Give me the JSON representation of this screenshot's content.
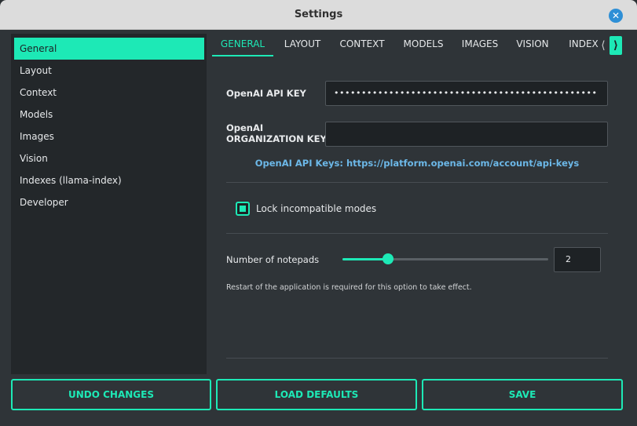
{
  "window": {
    "title": "Settings",
    "close_symbol": "✕"
  },
  "sidebar": {
    "items": [
      {
        "label": "General",
        "active": true
      },
      {
        "label": "Layout"
      },
      {
        "label": "Context"
      },
      {
        "label": "Models"
      },
      {
        "label": "Images"
      },
      {
        "label": "Vision"
      },
      {
        "label": "Indexes (llama-index)"
      },
      {
        "label": "Developer"
      }
    ]
  },
  "tabs": {
    "items": [
      {
        "label": "GENERAL",
        "active": true
      },
      {
        "label": "LAYOUT"
      },
      {
        "label": "CONTEXT"
      },
      {
        "label": "MODELS"
      },
      {
        "label": "IMAGES"
      },
      {
        "label": "VISION"
      },
      {
        "label": "INDEX"
      }
    ],
    "scroll_left_symbol": "⟨",
    "scroll_right_symbol": "⟩"
  },
  "general": {
    "api_key_label": "OpenAI API KEY",
    "api_key_value": "••••••••••••••••••••••••••••••••••••••••••••••••",
    "org_key_label_line1": "OpenAI",
    "org_key_label_line2": "ORGANIZATION KEY",
    "org_key_value": "",
    "api_keys_link": "OpenAI API Keys: https://platform.openai.com/account/api-keys",
    "lock_label": "Lock incompatible modes",
    "lock_checked": true,
    "notepads_label": "Number of notepads",
    "notepads_value": "2",
    "notepads_slider_fraction": 0.22,
    "restart_hint": "Restart of the application is required for this option to take effect."
  },
  "buttons": {
    "undo": "UNDO CHANGES",
    "defaults": "LOAD DEFAULTS",
    "save": "SAVE"
  },
  "colors": {
    "accent": "#1de9b6",
    "link": "#6cb8e8",
    "close": "#2e8fd6"
  },
  "icons": {
    "close": "close-icon",
    "check": "check-icon",
    "scroll_left": "chevron-left-icon",
    "scroll_right": "chevron-right-icon"
  }
}
